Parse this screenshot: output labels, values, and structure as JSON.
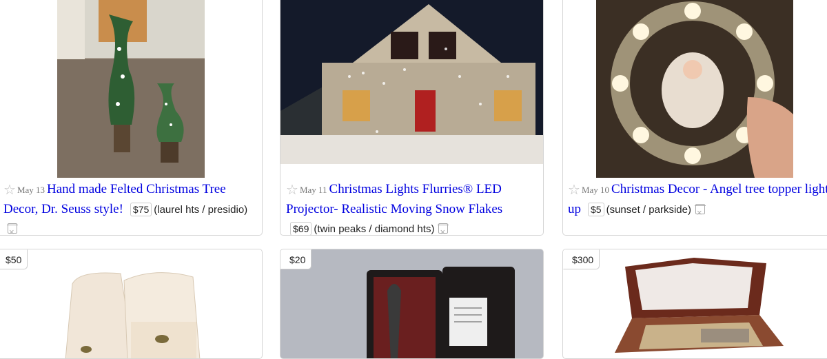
{
  "listings": [
    {
      "date": "May 13",
      "title": "Hand made Felted Christmas Tree Decor, Dr. Seuss style!",
      "price": "$75",
      "hood": "(laurel hts / presidio)"
    },
    {
      "date": "May 11",
      "title": "Christmas Lights Flurries® LED Projector- Realistic Moving Snow Flakes",
      "price": "$69",
      "hood": "(twin peaks / diamond hts)"
    },
    {
      "date": "May 10",
      "title": "Christmas Decor - Angel tree topper light up",
      "price": "$5",
      "hood": "(sunset / parkside)"
    },
    {
      "price": "$50"
    },
    {
      "price": "$20"
    },
    {
      "price": "$300"
    }
  ],
  "icons": {
    "favorite": "star-outline-icon",
    "hide": "trash-hide-icon"
  },
  "colors": {
    "link": "#0000e0",
    "date": "#777777",
    "border": "#d6d6d6"
  }
}
